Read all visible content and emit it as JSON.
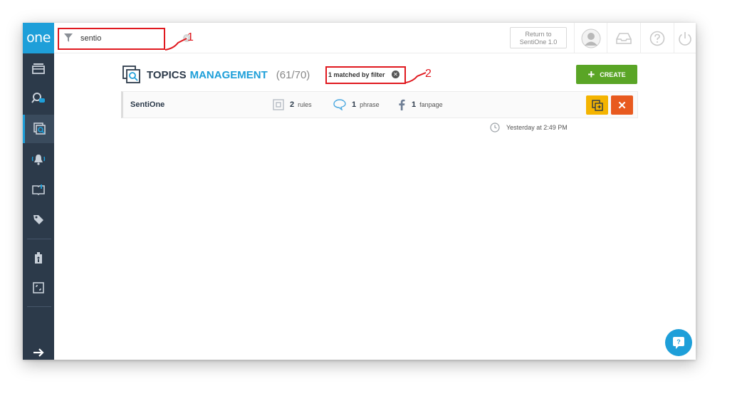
{
  "search": {
    "value": "sentio"
  },
  "topbar": {
    "return_line1": "Return to",
    "return_line2": "SentiOne 1.0"
  },
  "logo": "one",
  "page": {
    "title_part1": "TOPICS",
    "title_part2": "MANAGEMENT",
    "count": "(61/70)"
  },
  "filter_badge": "1 matched by filter",
  "create_label": "CREATE",
  "topic": {
    "name": "SentiOne",
    "rules_count": "2",
    "rules_label": "rules",
    "phrase_count": "1",
    "phrase_label": "phrase",
    "fanpage_count": "1",
    "fanpage_label": "fanpage",
    "updated": "Yesterday at 2:49 PM"
  },
  "annotations": [
    "1",
    "2"
  ],
  "colors": {
    "sidebar": "#2c3a4a",
    "accent": "#1e9fd9",
    "create": "#5aa526",
    "copy": "#f4b400",
    "delete": "#e85a1f",
    "annotation": "#e0191f"
  }
}
